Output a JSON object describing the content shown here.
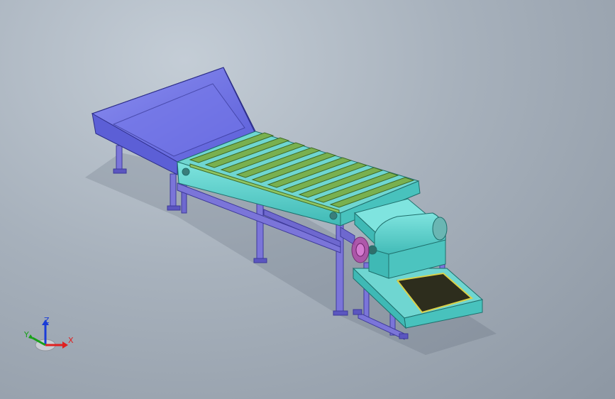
{
  "view": {
    "background_top": "#c4cdd6",
    "background_bottom": "#8d97a3"
  },
  "model": {
    "parts": [
      "feed-hopper",
      "belt-conveyor",
      "conveyor-slats",
      "conveyor-support-frame",
      "crusher-housing",
      "crusher-motor",
      "vibrating-screen",
      "screen-stand"
    ],
    "colors": {
      "hopper": "#6f72e6",
      "conveyor_side": "#5fd3cf",
      "slats": "#79b04f",
      "frame": "#7b75d9",
      "screen_mesh": "#2d2d1d",
      "screen_rim": "#d8d04a",
      "motor": "#b04aa8"
    }
  },
  "triad": {
    "x_label": "X",
    "y_label": "Y",
    "z_label": "Z",
    "x_color": "#e02020",
    "y_color": "#18a018",
    "z_color": "#1a3cd8"
  }
}
